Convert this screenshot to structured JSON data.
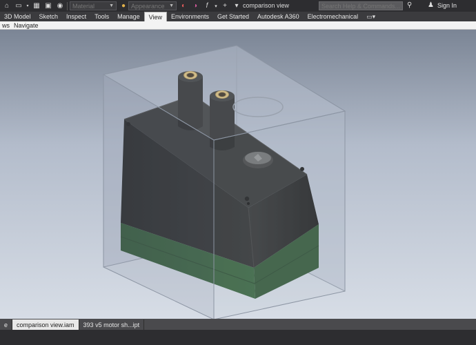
{
  "quick_access": {
    "material_placeholder": "Material",
    "appearance_placeholder": "Appearance",
    "icons": [
      "home-icon",
      "open-file-icon",
      "project-icon",
      "save-icon",
      "material-sphere-icon",
      "appearance-sphere-icon",
      "clear-appearance-icon",
      "function-icon",
      "add-icon",
      "more-icon"
    ]
  },
  "window_title": "comparison view",
  "search": {
    "placeholder": "Search Help & Commands..."
  },
  "signin_label": "Sign In",
  "ribbon_tabs": [
    {
      "label": "3D Model",
      "active": false
    },
    {
      "label": "Sketch",
      "active": false
    },
    {
      "label": "Inspect",
      "active": false
    },
    {
      "label": "Tools",
      "active": false
    },
    {
      "label": "Manage",
      "active": false
    },
    {
      "label": "View",
      "active": true
    },
    {
      "label": "Environments",
      "active": false
    },
    {
      "label": "Get Started",
      "active": false
    },
    {
      "label": "Autodesk A360",
      "active": false
    },
    {
      "label": "Electromechanical",
      "active": false
    }
  ],
  "panels": {
    "left_fragment": "ws",
    "navigate": "Navigate"
  },
  "documents": [
    {
      "label": "e",
      "active": false
    },
    {
      "label": "comparison view.iam",
      "active": true
    },
    {
      "label": "393 v5 motor sh...ipt",
      "active": false
    }
  ],
  "colors": {
    "accent_active_tab": "#f2f2f2",
    "body_black": "#1e1f1f",
    "base_green": "#2f5d35",
    "brass": "#c9a45a"
  }
}
